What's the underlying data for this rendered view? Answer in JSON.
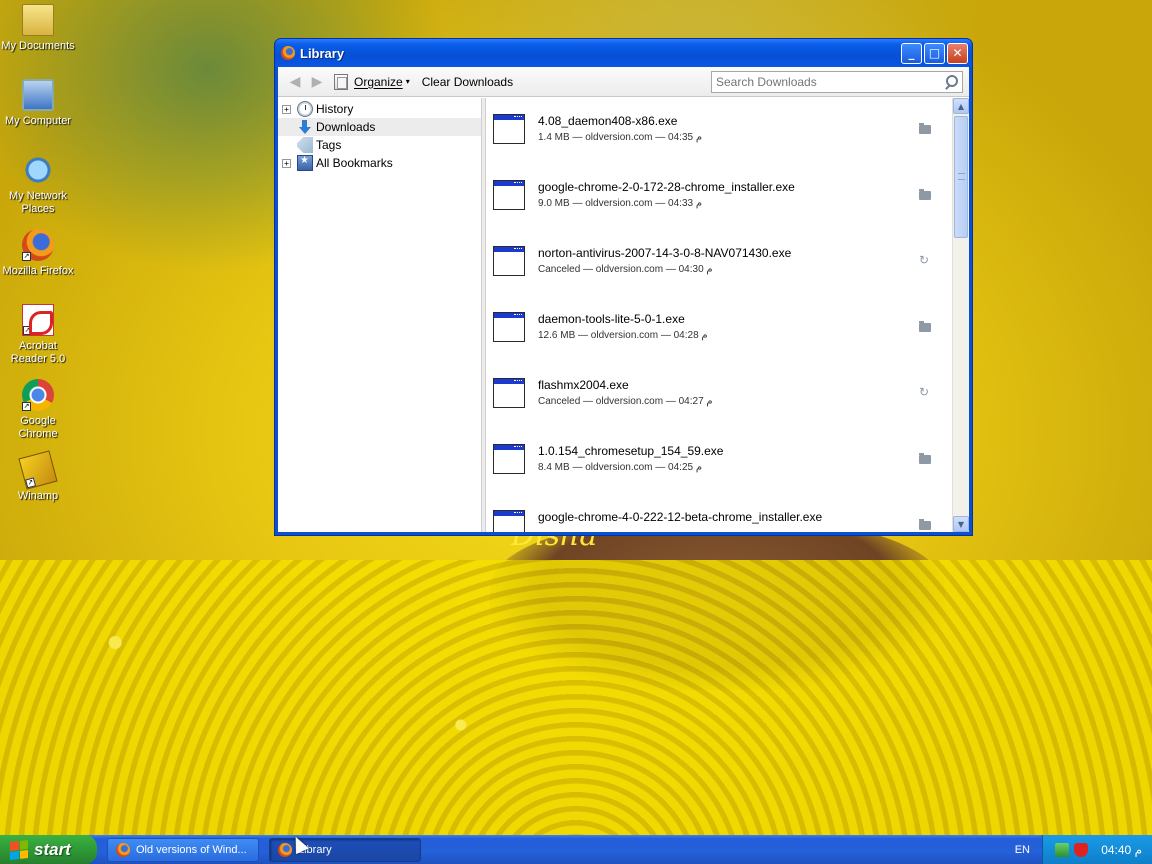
{
  "desktop": {
    "wallpaper_text": "Disha",
    "icons": [
      {
        "label": "My Documents",
        "icon": "my-documents-icon",
        "shortcut": false
      },
      {
        "label": "My Computer",
        "icon": "my-computer-icon",
        "shortcut": false
      },
      {
        "label": "My Network Places",
        "icon": "network-places-icon",
        "shortcut": false
      },
      {
        "label": "Mozilla Firefox",
        "icon": "firefox-icon",
        "shortcut": true
      },
      {
        "label": "Acrobat Reader 5.0",
        "icon": "acrobat-icon",
        "shortcut": true
      },
      {
        "label": "Google Chrome",
        "icon": "chrome-icon",
        "shortcut": true
      },
      {
        "label": "Winamp",
        "icon": "winamp-icon",
        "shortcut": true
      }
    ]
  },
  "window": {
    "title": "Library",
    "controls": {
      "minimize": "_",
      "maximize": "□",
      "close": "✕"
    },
    "toolbar": {
      "back": "◀",
      "forward": "▶",
      "organize_label": "Organize",
      "organize_caret": "▾",
      "clear_downloads_label": "Clear Downloads",
      "search_placeholder": "Search Downloads"
    },
    "sidebar": {
      "items": [
        {
          "label": "History",
          "expandable": true,
          "expander": "+",
          "selected": false
        },
        {
          "label": "Downloads",
          "expandable": false,
          "expander": "",
          "selected": true
        },
        {
          "label": "Tags",
          "expandable": false,
          "expander": "",
          "selected": false
        },
        {
          "label": "All Bookmarks",
          "expandable": true,
          "expander": "+",
          "selected": false
        }
      ]
    },
    "downloads": [
      {
        "name": "4.08_daemon408-x86.exe",
        "status": "1.4 MB — oldversion.com — 04:35 م",
        "action": "open-folder"
      },
      {
        "name": "google-chrome-2-0-172-28-chrome_installer.exe",
        "status": "9.0 MB — oldversion.com — 04:33 م",
        "action": "open-folder"
      },
      {
        "name": "norton-antivirus-2007-14-3-0-8-NAV071430.exe",
        "status": "Canceled — oldversion.com — 04:30 م",
        "action": "retry"
      },
      {
        "name": "daemon-tools-lite-5-0-1.exe",
        "status": "12.6 MB — oldversion.com — 04:28 م",
        "action": "open-folder"
      },
      {
        "name": "flashmx2004.exe",
        "status": "Canceled — oldversion.com — 04:27 م",
        "action": "retry"
      },
      {
        "name": "1.0.154_chromesetup_154_59.exe",
        "status": "8.4 MB — oldversion.com — 04:25 م",
        "action": "open-folder"
      },
      {
        "name": "google-chrome-4-0-222-12-beta-chrome_installer.exe",
        "status": "",
        "action": "open-folder"
      }
    ],
    "scrollbar": {
      "up": "▲",
      "down": "▼"
    }
  },
  "taskbar": {
    "start_label": "start",
    "tasks": [
      {
        "label": "Old versions of Wind...",
        "active": false
      },
      {
        "label": "Library",
        "active": true
      }
    ],
    "language": "EN",
    "clock": "04:40 م"
  }
}
